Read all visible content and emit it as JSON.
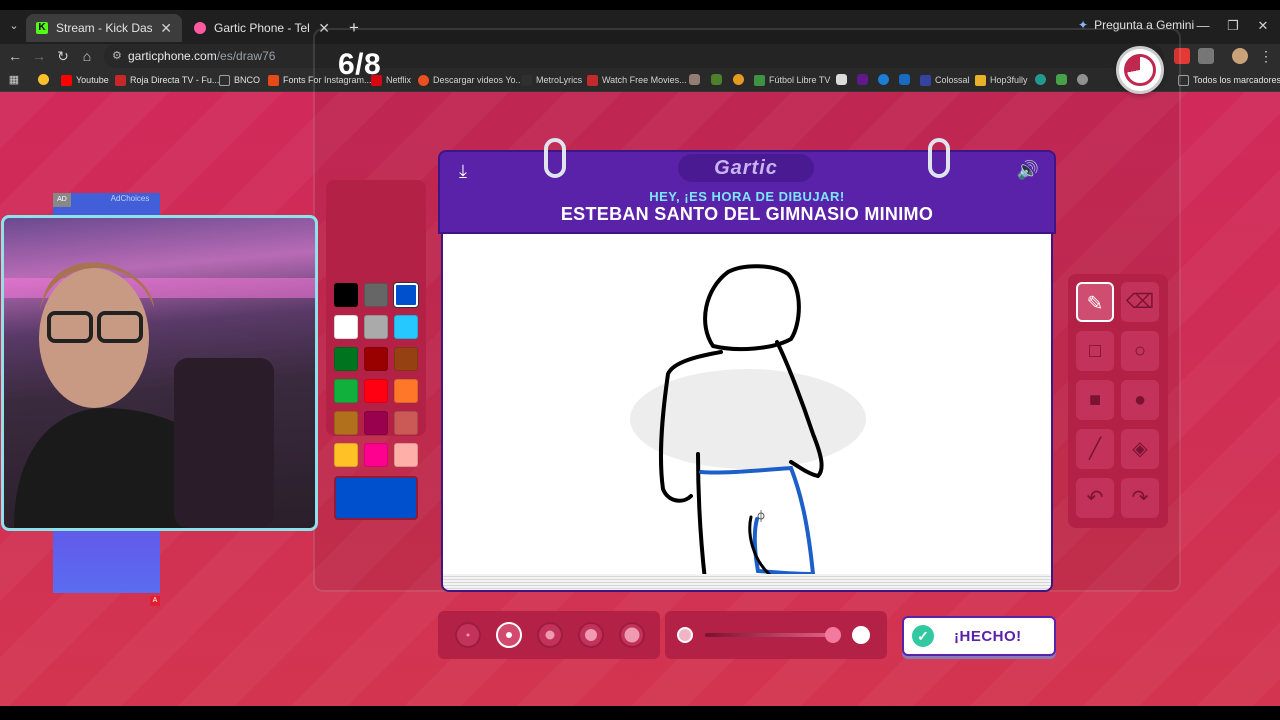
{
  "browser": {
    "tabs": [
      {
        "title": "Stream - Kick Dashboard",
        "active": true
      },
      {
        "title": "Gartic Phone - Teléfono Descon",
        "active": false
      }
    ],
    "gemini_label": "Pregunta a Gemini",
    "url_host": "garticphone.com",
    "url_path": "/es/draw76",
    "bookmarks": [
      {
        "label": "Youtube",
        "color": "#ff0000"
      },
      {
        "label": "Roja Directa TV - Fu...",
        "color": "#c62828"
      },
      {
        "label": "BNCO",
        "color": "#9aa0a6"
      },
      {
        "label": "Fonts For Instagram...",
        "color": "#e64a19"
      },
      {
        "label": "Netflix",
        "color": "#e50914"
      },
      {
        "label": "Descargar videos Yo...",
        "color": "#ff5722"
      },
      {
        "label": "MetroLyrics",
        "color": "#333333"
      },
      {
        "label": "Watch Free Movies...",
        "color": "#d32f2f"
      },
      {
        "label": "Fútbol Libre TV",
        "color": "#43a047"
      },
      {
        "label": "Colossal",
        "color": "#3949ab"
      },
      {
        "label": "Hop3fully",
        "color": "#fbc02d"
      }
    ],
    "all_bookmarks_label": "Todos los marcadores"
  },
  "game": {
    "round": "6/8",
    "logo": "Gartic",
    "prompt_hint": "HEY, ¡ES HORA DE DIBUJAR!",
    "prompt_word": "ESTEBAN SANTO DEL GIMNASIO MINIMO",
    "done_label": "¡HECHO!",
    "timer_remaining_fraction": 0.72,
    "palette": [
      "#000000",
      "#666666",
      "#0050cd",
      "#ffffff",
      "#aaaaaa",
      "#26c9ff",
      "#017420",
      "#990000",
      "#964112",
      "#11b03c",
      "#ff0013",
      "#ff7829",
      "#b0701c",
      "#99004e",
      "#cb5a57",
      "#ffc126",
      "#ff008f",
      "#feafa8"
    ],
    "selected_color": "#0050cd",
    "tools": [
      "pencil-icon",
      "eraser-icon",
      "rectangle-outline-icon",
      "circle-outline-icon",
      "rectangle-filled-icon",
      "circle-filled-icon",
      "line-icon",
      "fill-bucket-icon",
      "undo-icon",
      "redo-icon"
    ],
    "selected_tool": "pencil-icon",
    "brush_sizes": 5,
    "selected_size_index": 1
  },
  "overlay": {
    "ad_label": "AD",
    "ad_choices": "AdChoices",
    "ad_badge": "A"
  }
}
